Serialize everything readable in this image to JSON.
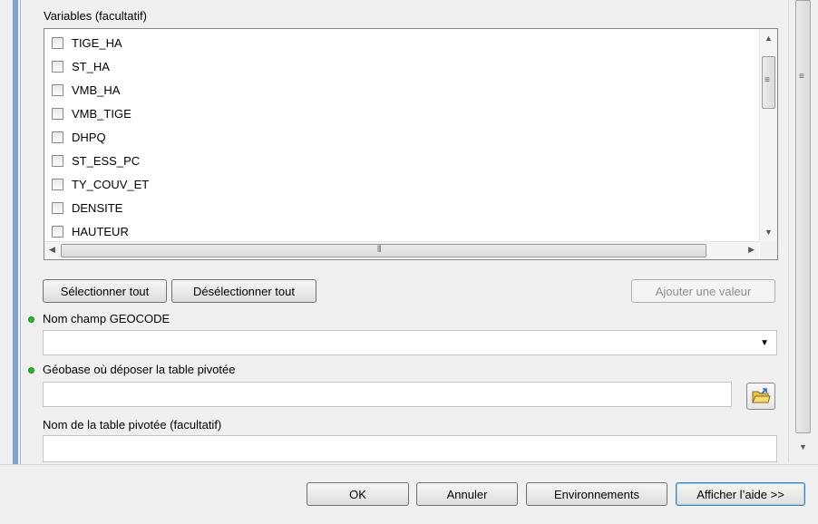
{
  "variables_section": {
    "label": "Variables (facultatif)",
    "items": [
      {
        "label": "TIGE_HA",
        "checked": false
      },
      {
        "label": "ST_HA",
        "checked": false
      },
      {
        "label": "VMB_HA",
        "checked": false
      },
      {
        "label": "VMB_TIGE",
        "checked": false
      },
      {
        "label": "DHPQ",
        "checked": false
      },
      {
        "label": "ST_ESS_PC",
        "checked": false
      },
      {
        "label": "TY_COUV_ET",
        "checked": false
      },
      {
        "label": "DENSITE",
        "checked": false
      },
      {
        "label": "HAUTEUR",
        "checked": false
      }
    ]
  },
  "list_buttons": {
    "select_all": "Sélectionner tout",
    "deselect_all": "Désélectionner tout",
    "add_value": "Ajouter une valeur"
  },
  "geocode_field": {
    "label": "Nom champ GEOCODE",
    "value": "",
    "required": true
  },
  "geobase_field": {
    "label": "Géobase où déposer la table pivotée",
    "value": "",
    "required": true
  },
  "table_name_field": {
    "label": "Nom de la table pivotée (facultatif)",
    "value": ""
  },
  "dialog_buttons": {
    "ok": "OK",
    "cancel": "Annuler",
    "environments": "Environnements",
    "show_help": "Afficher l’aide >>"
  },
  "colors": {
    "required_dot": "#21c021",
    "window_bg": "#f0f0f0",
    "focus_border": "#3c7fb1"
  },
  "icons": {
    "scroll_up": "up-arrow-icon",
    "scroll_down": "down-arrow-icon",
    "scroll_left": "left-arrow-icon",
    "scroll_right": "right-arrow-icon",
    "browse": "open-folder-icon"
  }
}
